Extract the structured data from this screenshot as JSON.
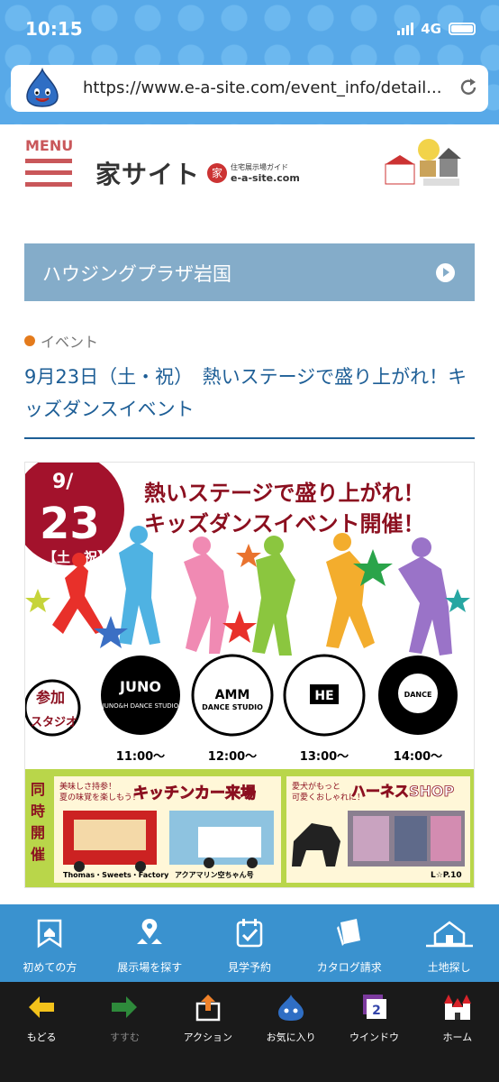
{
  "status": {
    "time": "10:15",
    "network": "4G"
  },
  "browser": {
    "url": "https://www.e-a-site.com/event_info/detail..."
  },
  "header": {
    "menu_label": "MENU",
    "logo_main": "家サイト",
    "logo_badge": "家",
    "logo_sub": "e-a-site.com",
    "logo_tagline": "住宅展示場ガイド"
  },
  "banner": {
    "label": "ハウジングプラザ岩国"
  },
  "article": {
    "category": "イベント",
    "title": "9月23日（土・祝）　熱いステージで盛り上がれ！キッズダンスイベント"
  },
  "poster": {
    "date_month": "9/",
    "date_day": "23",
    "date_note": "【土・祝】",
    "headline1": "熱いステージで盛り上がれ！",
    "headline2": "キッズダンスイベント開催！",
    "studio_label1": "参加",
    "studio_label2": "スタジオ",
    "studios": [
      {
        "name": "JUNO",
        "sub": "JUNO&H DANCE STUDIO",
        "time": "11:00～"
      },
      {
        "name": "AMM",
        "sub": "DANCE STUDIO",
        "time": "12:00～"
      },
      {
        "name": "HE",
        "sub": "",
        "time": "13:00～"
      },
      {
        "name": "",
        "sub": "DANCE",
        "time": "14:00～"
      }
    ],
    "side_label": "同時開催",
    "kitchen": {
      "note1": "美味しさ持参！",
      "note2": "夏の味覚を楽しもう！",
      "title": "キッチンカー来場",
      "car1": "Thomas・Sweets・Factory",
      "car2": "アクアマリン空ちゃん号"
    },
    "harness": {
      "note1": "愛犬がもっと",
      "note2": "可愛くおしゃれに！",
      "title": "ハーネスSHOP",
      "place": "L☆P.10"
    }
  },
  "site_nav": [
    "初めての方",
    "展示場を探す",
    "見学予約",
    "カタログ請求",
    "土地探し"
  ],
  "toolbar": [
    "もどる",
    "すすむ",
    "アクション",
    "お気に入り",
    "ウインドウ",
    "ホーム"
  ],
  "toolbar_badge": "2",
  "colors": {
    "accent_red": "#c9575a",
    "banner": "#84acc9",
    "link_blue": "#1d5e96",
    "nav_blue": "#3a92cf"
  }
}
